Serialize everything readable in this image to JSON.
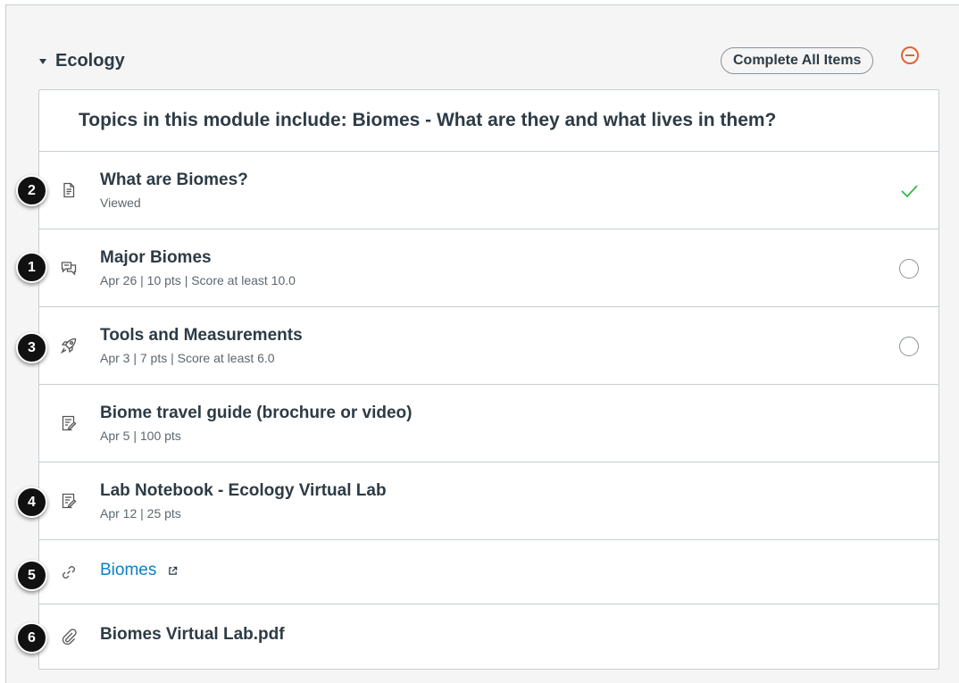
{
  "module": {
    "title": "Ecology",
    "complete_all_label": "Complete All Items",
    "subheader": "Topics in this module include: Biomes - What are they and what lives in them?"
  },
  "items": [
    {
      "title": "What are Biomes?",
      "meta": "Viewed",
      "icon": "page-icon",
      "status": "completed",
      "badge": "2"
    },
    {
      "title": "Major Biomes",
      "meta": "Apr 26  |  10 pts  |  Score at least 10.0",
      "icon": "discussion-icon",
      "status": "incomplete",
      "badge": "1"
    },
    {
      "title": "Tools and Measurements",
      "meta": "Apr 3  |  7 pts  |  Score at least 6.0",
      "icon": "quiz-icon",
      "status": "incomplete",
      "badge": "3"
    },
    {
      "title": "Biome travel guide (brochure or video)",
      "meta": "Apr 5  |  100 pts",
      "icon": "assignment-icon",
      "status": "none",
      "badge": ""
    },
    {
      "title": "Lab Notebook - Ecology Virtual Lab",
      "meta": "Apr 12  |  25 pts",
      "icon": "assignment-icon",
      "status": "none",
      "badge": "4"
    },
    {
      "title": "Biomes",
      "meta": "",
      "icon": "link-icon",
      "status": "none",
      "badge": "5"
    },
    {
      "title": "Biomes Virtual Lab.pdf",
      "meta": "",
      "icon": "attachment-icon",
      "status": "none",
      "badge": "6"
    }
  ],
  "colors": {
    "link": "#0b7fc7",
    "complete": "#3ab54a",
    "remove": "#e66135"
  }
}
